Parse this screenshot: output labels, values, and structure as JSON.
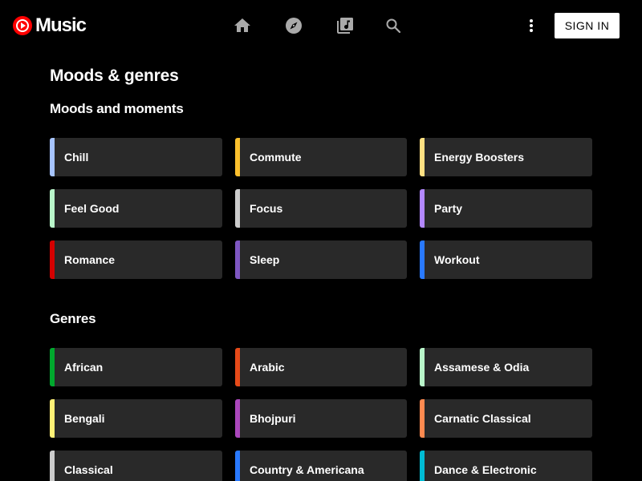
{
  "header": {
    "logo_text": "Music",
    "nav_icons": [
      "home-icon",
      "explore-icon",
      "library-icon",
      "search-icon"
    ],
    "sign_in_label": "SIGN IN",
    "brand_color": "#ff0000"
  },
  "page_title": "Moods & genres",
  "moods": {
    "title": "Moods and moments",
    "items": [
      {
        "label": "Chill",
        "color": "#a6c4ff"
      },
      {
        "label": "Commute",
        "color": "#fbc02d"
      },
      {
        "label": "Energy Boosters",
        "color": "#ffe082"
      },
      {
        "label": "Feel Good",
        "color": "#b9f6ca"
      },
      {
        "label": "Focus",
        "color": "#cccccc"
      },
      {
        "label": "Party",
        "color": "#b388ff"
      },
      {
        "label": "Romance",
        "color": "#d50000"
      },
      {
        "label": "Sleep",
        "color": "#7e57c2"
      },
      {
        "label": "Workout",
        "color": "#2979ff"
      }
    ]
  },
  "genres": {
    "title": "Genres",
    "items": [
      {
        "label": "African",
        "color": "#00a82d"
      },
      {
        "label": "Arabic",
        "color": "#e64a19"
      },
      {
        "label": "Assamese & Odia",
        "color": "#b9f6ca"
      },
      {
        "label": "Bengali",
        "color": "#fff176"
      },
      {
        "label": "Bhojpuri",
        "color": "#ab47bc"
      },
      {
        "label": "Carnatic Classical",
        "color": "#ff8a50"
      },
      {
        "label": "Classical",
        "color": "#cccccc"
      },
      {
        "label": "Country & Americana",
        "color": "#2979ff"
      },
      {
        "label": "Dance & Electronic",
        "color": "#00bcd4"
      }
    ]
  }
}
